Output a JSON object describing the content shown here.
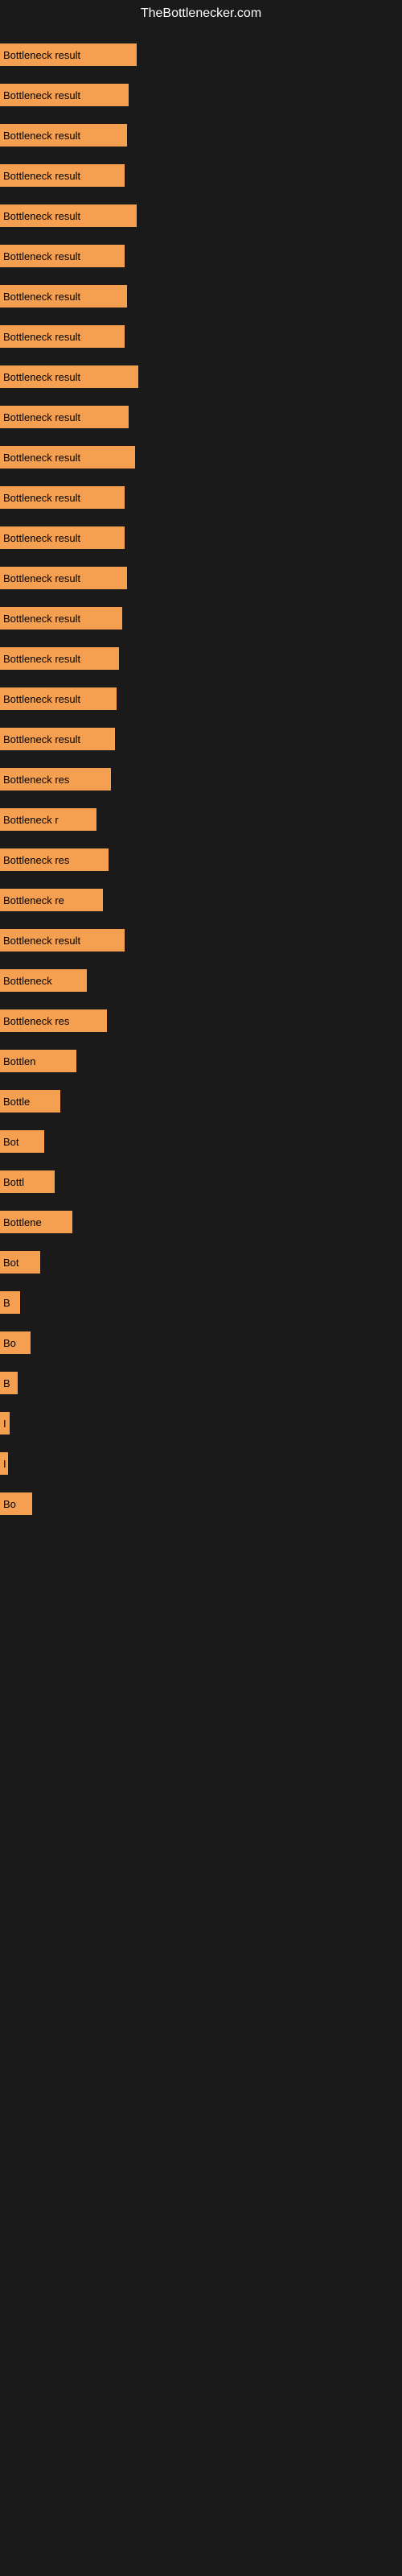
{
  "site": {
    "title": "TheBottlenecker.com"
  },
  "bars": [
    {
      "label": "Bottleneck result",
      "width": 170
    },
    {
      "label": "Bottleneck result",
      "width": 160
    },
    {
      "label": "Bottleneck result",
      "width": 158
    },
    {
      "label": "Bottleneck result",
      "width": 155
    },
    {
      "label": "Bottleneck result",
      "width": 170
    },
    {
      "label": "Bottleneck result",
      "width": 155
    },
    {
      "label": "Bottleneck result",
      "width": 158
    },
    {
      "label": "Bottleneck result",
      "width": 155
    },
    {
      "label": "Bottleneck result",
      "width": 172
    },
    {
      "label": "Bottleneck result",
      "width": 160
    },
    {
      "label": "Bottleneck result",
      "width": 168
    },
    {
      "label": "Bottleneck result",
      "width": 155
    },
    {
      "label": "Bottleneck result",
      "width": 155
    },
    {
      "label": "Bottleneck result",
      "width": 158
    },
    {
      "label": "Bottleneck result",
      "width": 152
    },
    {
      "label": "Bottleneck result",
      "width": 148
    },
    {
      "label": "Bottleneck result",
      "width": 145
    },
    {
      "label": "Bottleneck result",
      "width": 143
    },
    {
      "label": "Bottleneck res",
      "width": 138
    },
    {
      "label": "Bottleneck r",
      "width": 120
    },
    {
      "label": "Bottleneck res",
      "width": 135
    },
    {
      "label": "Bottleneck re",
      "width": 128
    },
    {
      "label": "Bottleneck result",
      "width": 155
    },
    {
      "label": "Bottleneck",
      "width": 108
    },
    {
      "label": "Bottleneck res",
      "width": 133
    },
    {
      "label": "Bottlen",
      "width": 95
    },
    {
      "label": "Bottle",
      "width": 75
    },
    {
      "label": "Bot",
      "width": 55
    },
    {
      "label": "Bottl",
      "width": 68
    },
    {
      "label": "Bottlene",
      "width": 90
    },
    {
      "label": "Bot",
      "width": 50
    },
    {
      "label": "B",
      "width": 25
    },
    {
      "label": "Bo",
      "width": 38
    },
    {
      "label": "B",
      "width": 22
    },
    {
      "label": "I",
      "width": 12
    },
    {
      "label": "I",
      "width": 10
    },
    {
      "label": "Bo",
      "width": 40
    }
  ]
}
